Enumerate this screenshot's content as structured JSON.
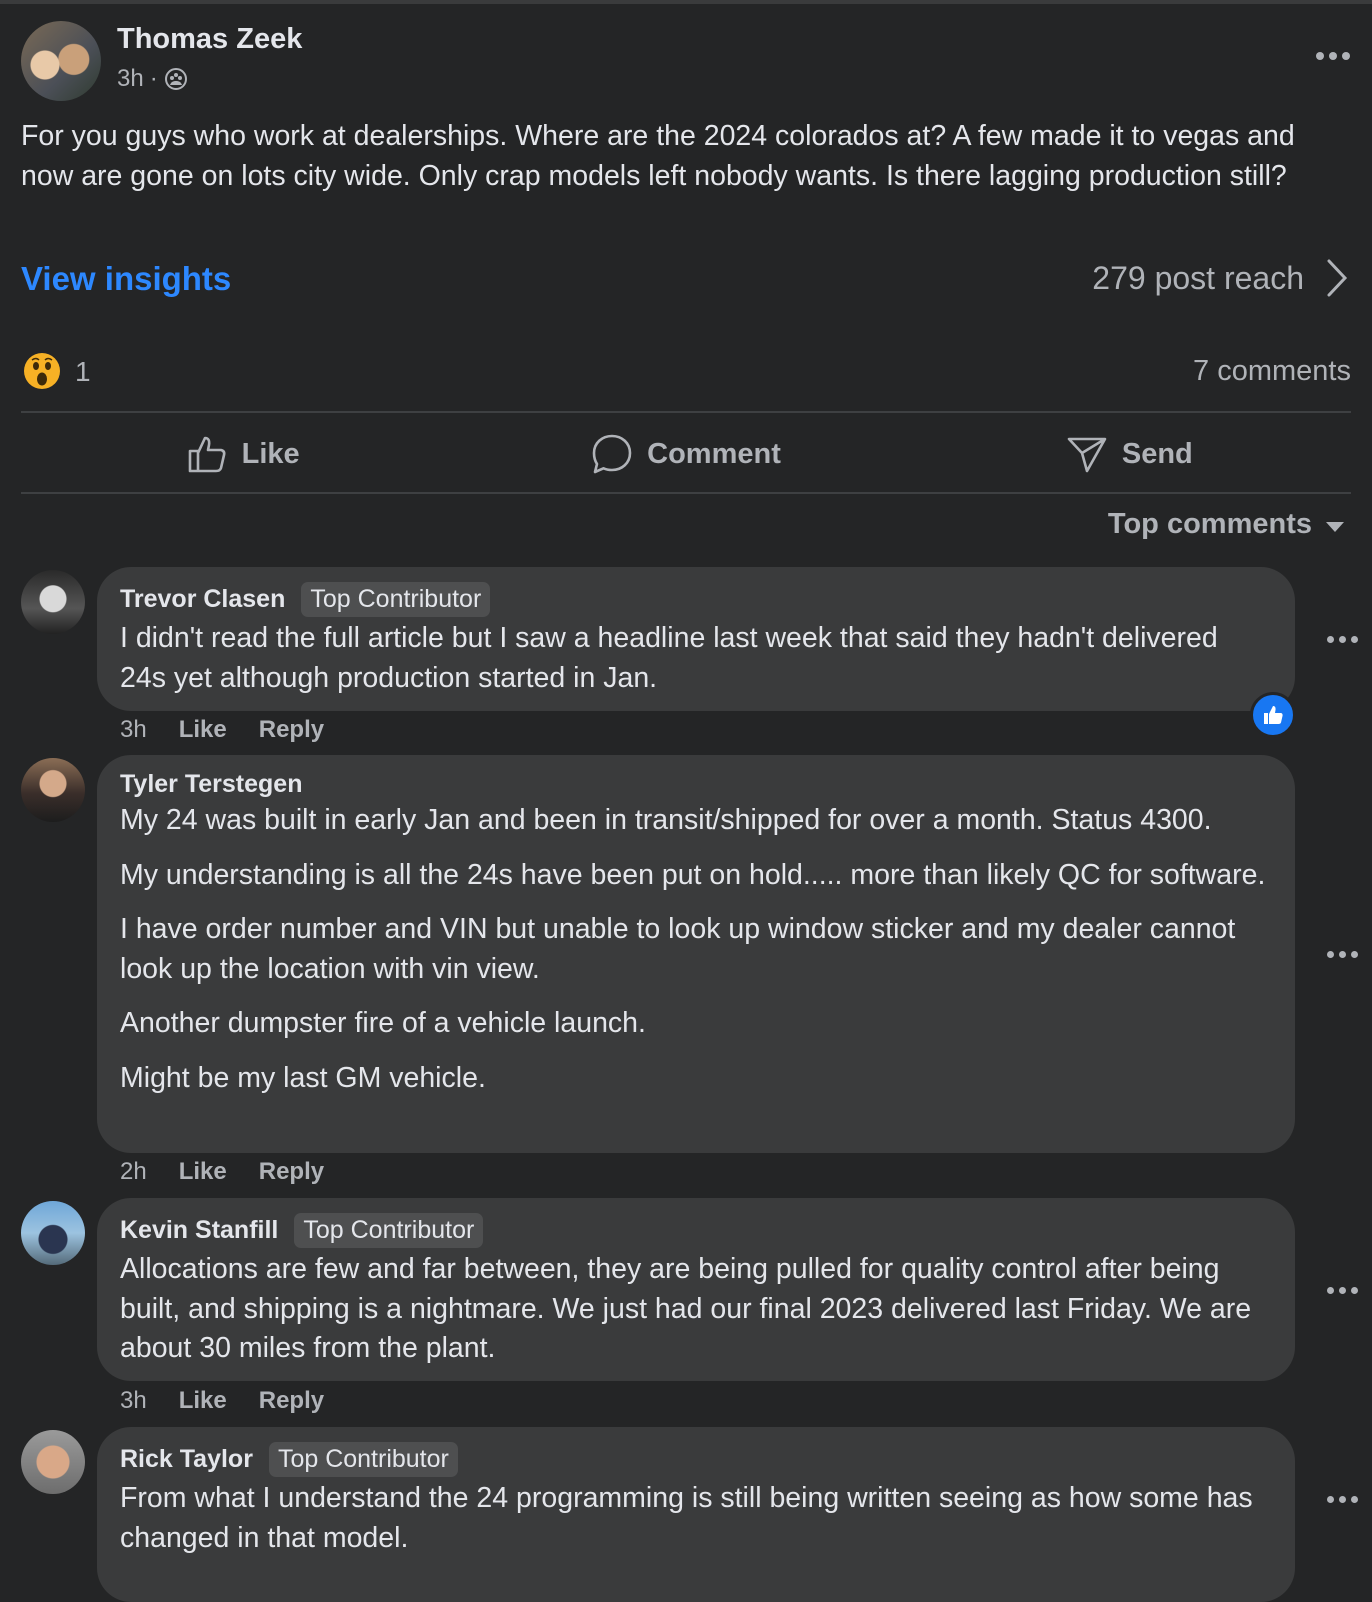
{
  "post": {
    "author": "Thomas Zeek",
    "time": "3h",
    "separator": "·",
    "text": "For you guys who work at dealerships. Where are the 2024 colorados at? A few made it to vegas and now are gone on lots city wide. Only crap models left nobody wants. Is there lagging production still?",
    "insights_label": "View insights",
    "reach_label": "279 post reach",
    "reaction_count": "1",
    "comments_label": "7 comments"
  },
  "actions": {
    "like": "Like",
    "comment": "Comment",
    "send": "Send"
  },
  "sort_label": "Top comments",
  "comments": [
    {
      "name": "Trevor Clasen",
      "badge": "Top Contributor",
      "paragraphs": [
        "I didn't read the full article but I saw a headline last week that said they hadn't delivered 24s yet although production started in Jan."
      ],
      "time": "3h",
      "like": "Like",
      "reply": "Reply"
    },
    {
      "name": "Tyler Terstegen",
      "badge": "",
      "paragraphs": [
        "My 24 was built in early Jan and been in transit/shipped for over a month. Status 4300.",
        "My understanding is all the 24s have been put on hold..... more than likely QC for software.",
        "I have order number and VIN but unable to look up window sticker and my dealer cannot look up the location with vin view.",
        "Another dumpster fire of a vehicle launch.",
        "Might be my last GM vehicle."
      ],
      "time": "2h",
      "like": "Like",
      "reply": "Reply"
    },
    {
      "name": "Kevin Stanfill",
      "badge": "Top Contributor",
      "paragraphs": [
        "Allocations are few and far between, they are being pulled for quality control after being built, and shipping is a nightmare. We just had our final 2023 delivered last Friday. We are about 30 miles from the plant."
      ],
      "time": "3h",
      "like": "Like",
      "reply": "Reply"
    },
    {
      "name": "Rick Taylor",
      "badge": "Top Contributor",
      "paragraphs": [
        "From what I understand the 24 programming is still being written seeing as how some has changed in that model."
      ]
    }
  ],
  "colors": {
    "background": "#242526",
    "bubble": "#3a3b3c",
    "link": "#2d88ff",
    "like_blue": "#1877f2"
  },
  "icons": [
    "globe-icon",
    "more-icon",
    "chevron-right-icon",
    "wow-reaction-icon",
    "like-icon",
    "comment-icon",
    "send-icon",
    "caret-down-icon"
  ]
}
